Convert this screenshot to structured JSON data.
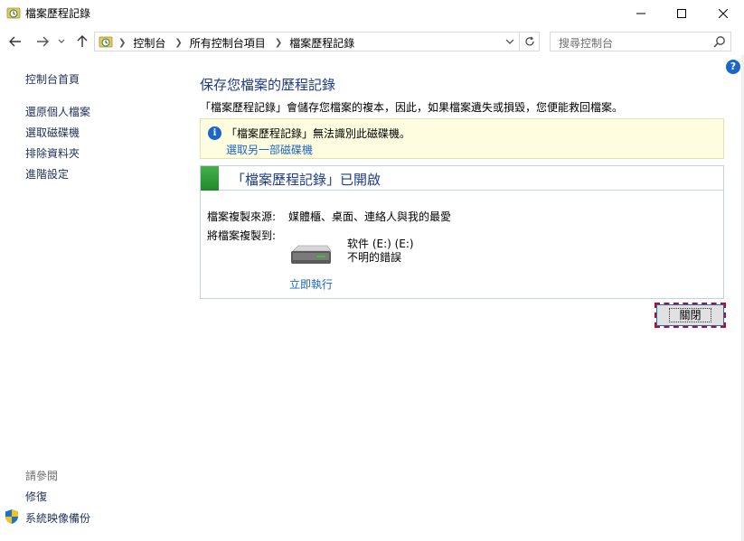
{
  "window": {
    "title": "檔案歷程記錄",
    "icons": {
      "app": "file-history-icon",
      "minimize": "minimize-icon",
      "maximize": "maximize-icon",
      "close": "close-icon"
    }
  },
  "navigation": {
    "breadcrumbs": [
      "控制台",
      "所有控制台項目",
      "檔案歷程記錄"
    ],
    "search_placeholder": "搜尋控制台",
    "icons": {
      "back": "arrow-left-icon",
      "forward": "arrow-right-icon",
      "recent": "chevron-down-icon",
      "up": "arrow-up-icon",
      "refresh": "refresh-icon",
      "search": "search-icon"
    }
  },
  "help": {
    "label": "?"
  },
  "sidebar": {
    "links": [
      "控制台首頁",
      "還原個人檔案",
      "選取磁碟機",
      "排除資料夾",
      "進階設定"
    ],
    "see_also_label": "請參閱",
    "see_also_links": [
      "修復",
      "系統映像備份"
    ]
  },
  "main": {
    "title": "保存您檔案的歷程記錄",
    "description": "「檔案歷程記錄」會儲存您檔案的複本，因此，如果檔案遺失或損毀，您便能救回檔案。",
    "info": {
      "icon_text": "i",
      "message": "「檔案歷程記錄」無法識別此磁碟機。",
      "link": "選取另一部磁碟機"
    },
    "status": {
      "title": "「檔案歷程記錄」已開啟",
      "color": "#2ea043",
      "source_label": "檔案複製來源:",
      "source_value": "媒體櫃、桌面、連絡人與我的最愛",
      "dest_label": "將檔案複製到:",
      "drive_name": "软件 (E:) (E:)",
      "drive_status": "不明的錯誤",
      "run_now": "立即執行"
    },
    "close_button": "關閉"
  }
}
